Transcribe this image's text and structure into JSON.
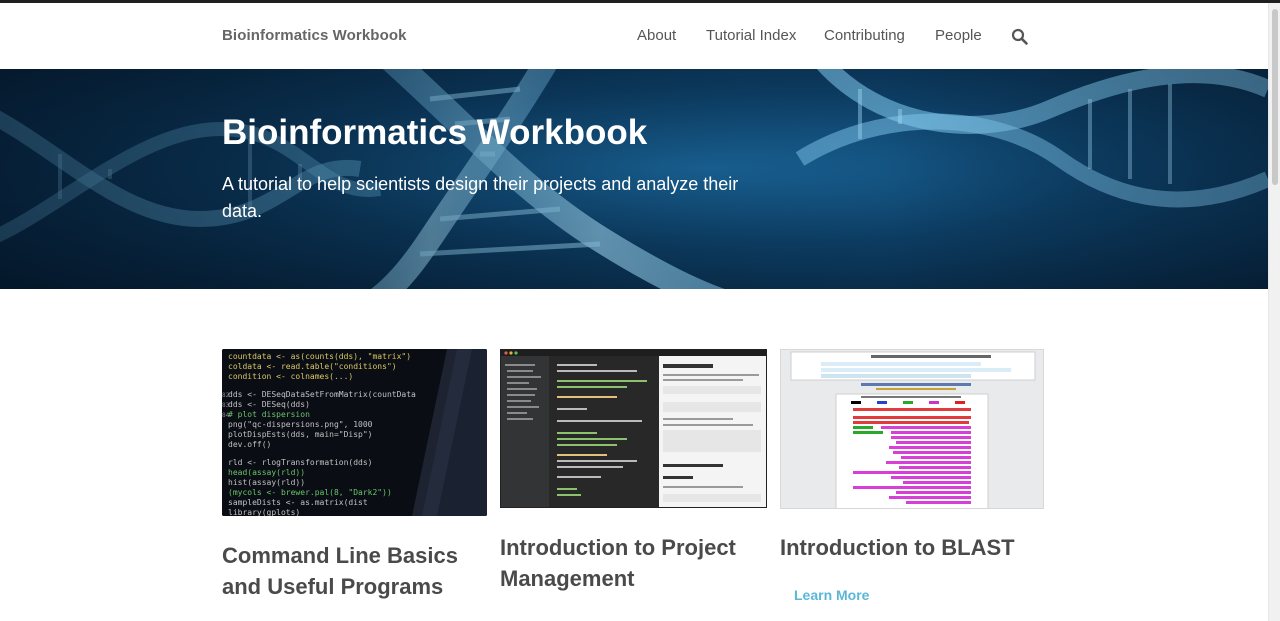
{
  "navbar": {
    "brand": "Bioinformatics Workbook",
    "links": [
      {
        "label": "About"
      },
      {
        "label": "Tutorial Index"
      },
      {
        "label": "Contributing"
      },
      {
        "label": "People"
      }
    ],
    "search_icon": "search-icon"
  },
  "hero": {
    "title": "Bioinformatics Workbook",
    "subtitle": "A tutorial to help scientists design their projects and analyze their data."
  },
  "cards": [
    {
      "title": "Command Line Basics and Useful Programs",
      "thumbnail": "code-screen-photo"
    },
    {
      "title": "Introduction to Project Management",
      "thumbnail": "editor-screenshot"
    },
    {
      "title": "Introduction to BLAST",
      "thumbnail": "blast-results-screenshot",
      "link_label": "Learn More"
    }
  ],
  "colors": {
    "brand_text": "#666666",
    "link_accent": "#5bb7d8",
    "hero_bg": "#0d3f66"
  }
}
